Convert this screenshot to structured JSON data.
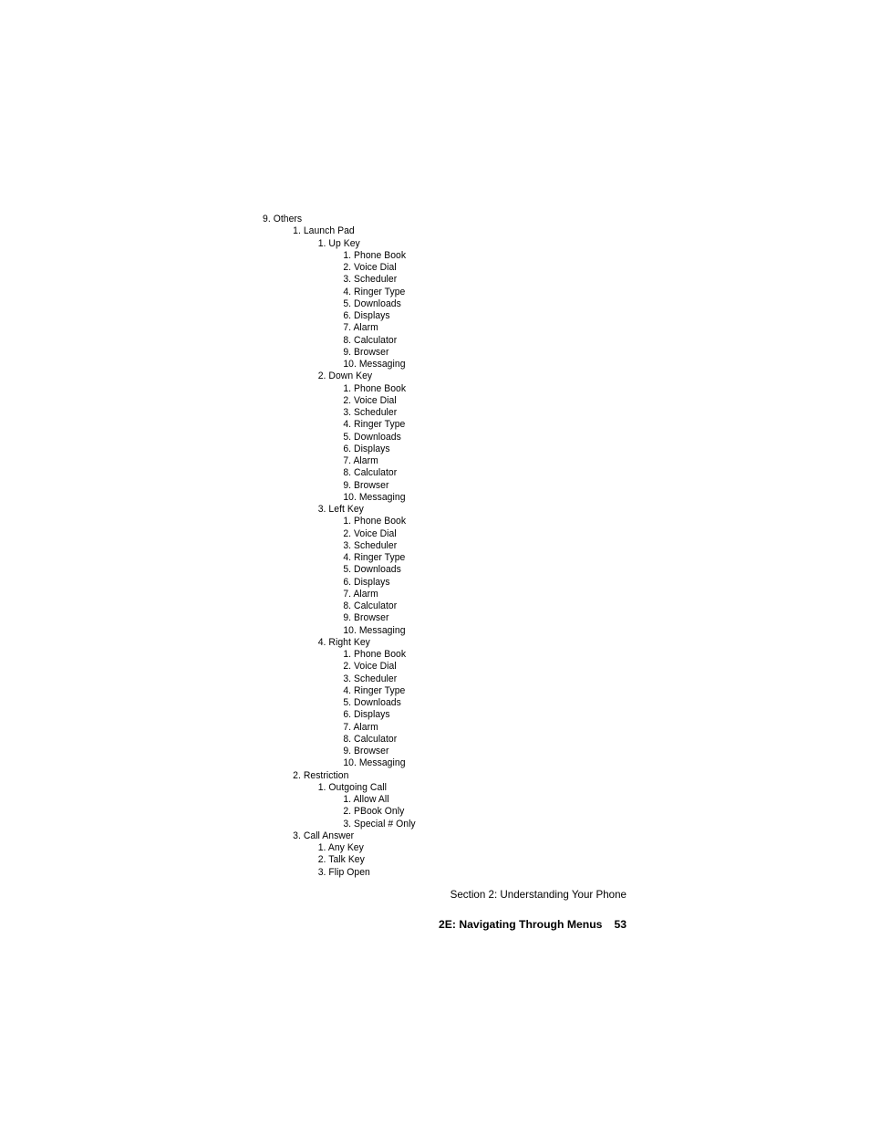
{
  "document": {
    "page_number": "53",
    "background_color": "#ffffff",
    "text_color": "#000000"
  },
  "outline": {
    "lines": [
      {
        "level": 0,
        "text": "9. Others"
      },
      {
        "level": 1,
        "text": "1. Launch Pad"
      },
      {
        "level": 2,
        "text": "1. Up Key"
      },
      {
        "level": 3,
        "text": "1. Phone Book"
      },
      {
        "level": 3,
        "text": "2. Voice Dial"
      },
      {
        "level": 3,
        "text": "3. Scheduler"
      },
      {
        "level": 3,
        "text": "4. Ringer Type"
      },
      {
        "level": 3,
        "text": "5. Downloads"
      },
      {
        "level": 3,
        "text": "6. Displays"
      },
      {
        "level": 3,
        "text": "7. Alarm"
      },
      {
        "level": 3,
        "text": "8. Calculator"
      },
      {
        "level": 3,
        "text": "9. Browser"
      },
      {
        "level": 3,
        "text": "10. Messaging"
      },
      {
        "level": 2,
        "text": "2. Down Key"
      },
      {
        "level": 3,
        "text": "1. Phone Book"
      },
      {
        "level": 3,
        "text": "2. Voice Dial"
      },
      {
        "level": 3,
        "text": "3. Scheduler"
      },
      {
        "level": 3,
        "text": "4. Ringer Type"
      },
      {
        "level": 3,
        "text": "5. Downloads"
      },
      {
        "level": 3,
        "text": "6. Displays"
      },
      {
        "level": 3,
        "text": "7. Alarm"
      },
      {
        "level": 3,
        "text": "8. Calculator"
      },
      {
        "level": 3,
        "text": "9. Browser"
      },
      {
        "level": 3,
        "text": "10. Messaging"
      },
      {
        "level": 2,
        "text": "3. Left Key"
      },
      {
        "level": 3,
        "text": "1. Phone Book"
      },
      {
        "level": 3,
        "text": "2. Voice Dial"
      },
      {
        "level": 3,
        "text": "3. Scheduler"
      },
      {
        "level": 3,
        "text": "4. Ringer Type"
      },
      {
        "level": 3,
        "text": "5. Downloads"
      },
      {
        "level": 3,
        "text": "6. Displays"
      },
      {
        "level": 3,
        "text": "7. Alarm"
      },
      {
        "level": 3,
        "text": "8. Calculator"
      },
      {
        "level": 3,
        "text": "9. Browser"
      },
      {
        "level": 3,
        "text": "10. Messaging"
      },
      {
        "level": 2,
        "text": "4. Right Key"
      },
      {
        "level": 3,
        "text": "1. Phone Book"
      },
      {
        "level": 3,
        "text": "2. Voice Dial"
      },
      {
        "level": 3,
        "text": "3. Scheduler"
      },
      {
        "level": 3,
        "text": "4. Ringer Type"
      },
      {
        "level": 3,
        "text": "5. Downloads"
      },
      {
        "level": 3,
        "text": "6. Displays"
      },
      {
        "level": 3,
        "text": "7. Alarm"
      },
      {
        "level": 3,
        "text": "8. Calculator"
      },
      {
        "level": 3,
        "text": "9. Browser"
      },
      {
        "level": 3,
        "text": "10. Messaging"
      },
      {
        "level": 1,
        "text": "2. Restriction"
      },
      {
        "level": 2,
        "text": "1. Outgoing Call"
      },
      {
        "level": 3,
        "text": "1. Allow All"
      },
      {
        "level": 3,
        "text": "2. PBook Only"
      },
      {
        "level": 3,
        "text": "3. Special # Only"
      },
      {
        "level": 1,
        "text": "3. Call Answer"
      },
      {
        "level": 2,
        "text": "1. Any Key"
      },
      {
        "level": 2,
        "text": "2. Talk Key"
      },
      {
        "level": 2,
        "text": "3. Flip Open"
      }
    ]
  },
  "footer": {
    "section_label": "Section 2: Understanding Your Phone",
    "chapter_label": "2E: Navigating Through Menus",
    "page_number": "53"
  }
}
